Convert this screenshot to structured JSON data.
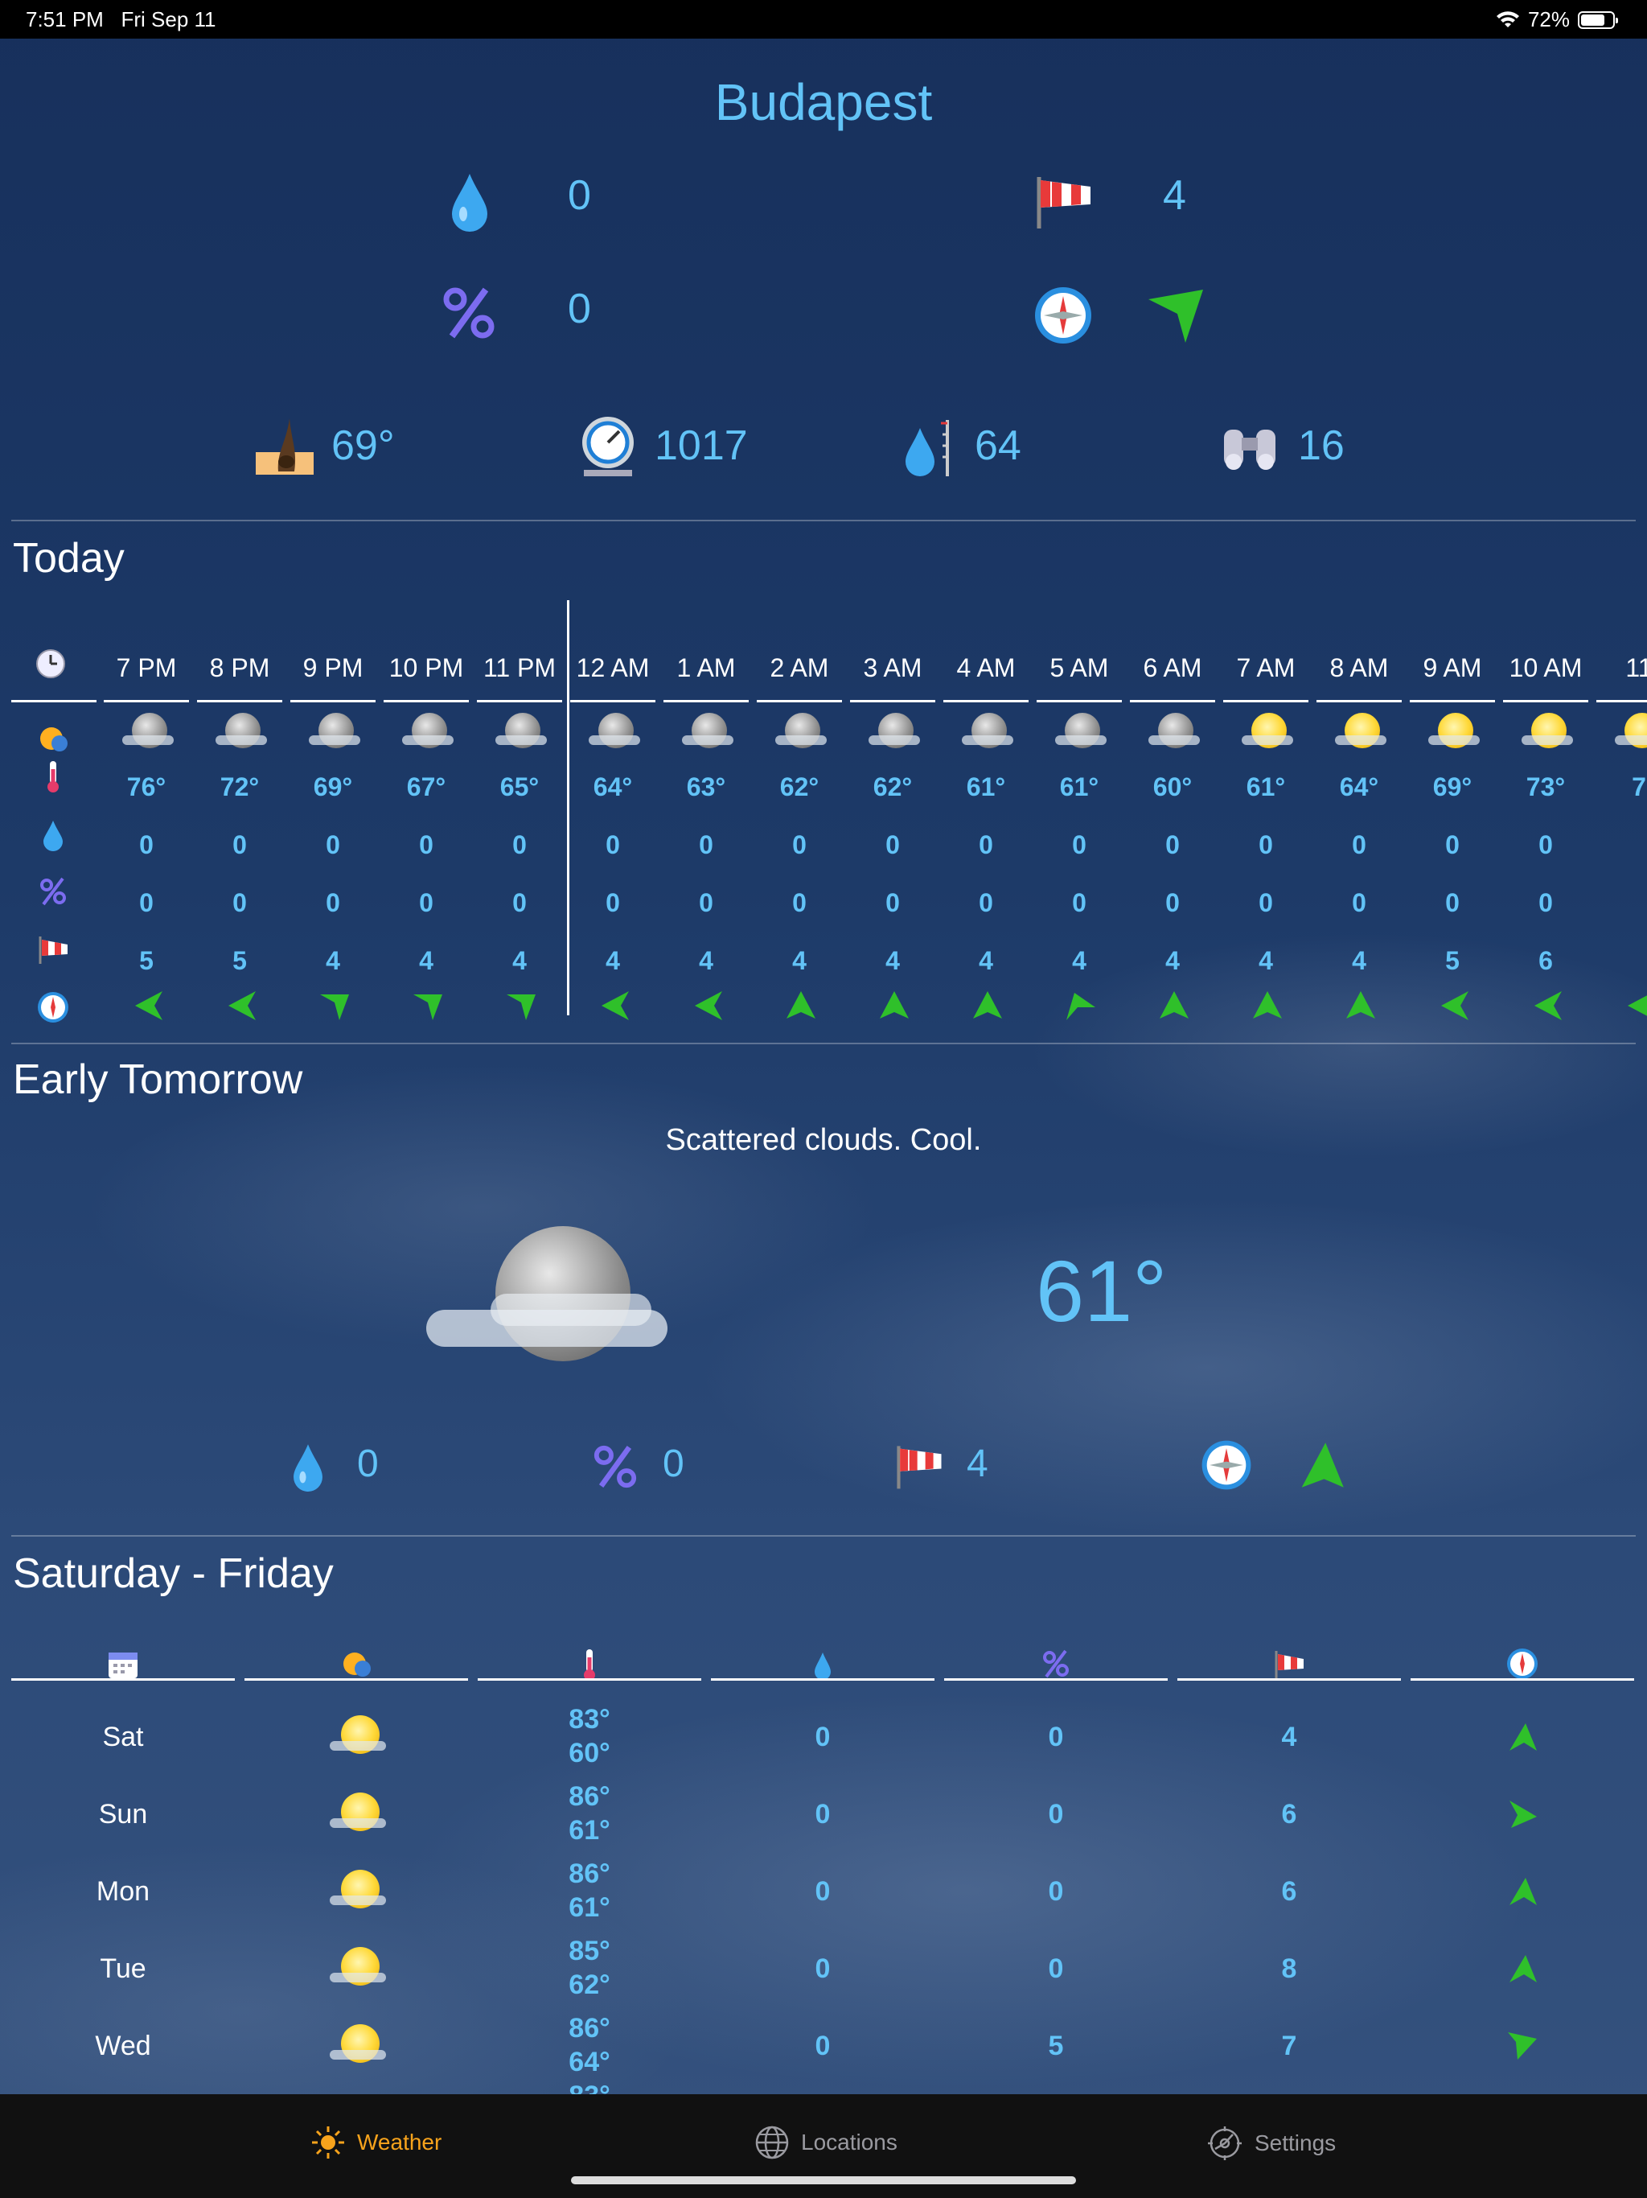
{
  "status": {
    "time": "7:51 PM",
    "date": "Fri Sep 11",
    "battery": "72%"
  },
  "city": "Budapest",
  "current": {
    "precip": "0",
    "precip_chance": "0",
    "wind": "4",
    "feels_like": "69°",
    "pressure": "1017",
    "humidity": "64",
    "visibility": "16"
  },
  "today": {
    "title": "Today",
    "hours": [
      "7 PM",
      "8 PM",
      "9 PM",
      "10 PM",
      "11 PM",
      "12 AM",
      "1 AM",
      "2 AM",
      "3 AM",
      "4 AM",
      "5 AM",
      "6 AM",
      "7 AM",
      "8 AM",
      "9 AM",
      "10 AM",
      "11"
    ],
    "icons": [
      "moon",
      "moon",
      "moon",
      "moon",
      "moon",
      "moon",
      "moon",
      "moon",
      "moon",
      "moon",
      "moon",
      "moon",
      "sun",
      "sun",
      "sun",
      "sun",
      "sun"
    ],
    "temps": [
      "76°",
      "72°",
      "69°",
      "67°",
      "65°",
      "64°",
      "63°",
      "62°",
      "62°",
      "61°",
      "61°",
      "60°",
      "61°",
      "64°",
      "69°",
      "73°",
      "7"
    ],
    "precip": [
      "0",
      "0",
      "0",
      "0",
      "0",
      "0",
      "0",
      "0",
      "0",
      "0",
      "0",
      "0",
      "0",
      "0",
      "0",
      "0",
      ""
    ],
    "chance": [
      "0",
      "0",
      "0",
      "0",
      "0",
      "0",
      "0",
      "0",
      "0",
      "0",
      "0",
      "0",
      "0",
      "0",
      "0",
      "0",
      ""
    ],
    "wind": [
      "5",
      "5",
      "4",
      "4",
      "4",
      "4",
      "4",
      "4",
      "4",
      "4",
      "4",
      "4",
      "4",
      "4",
      "5",
      "6",
      ""
    ]
  },
  "early_tomorrow": {
    "title": "Early Tomorrow",
    "summary": "Scattered clouds. Cool.",
    "temp": "61°",
    "precip": "0",
    "chance": "0",
    "wind": "4"
  },
  "daily": {
    "title": "Saturday - Friday",
    "rows": [
      {
        "day": "Sat",
        "high": "83°",
        "low": "60°",
        "precip": "0",
        "chance": "0",
        "wind": "4"
      },
      {
        "day": "Sun",
        "high": "86°",
        "low": "61°",
        "precip": "0",
        "chance": "0",
        "wind": "6"
      },
      {
        "day": "Mon",
        "high": "86°",
        "low": "61°",
        "precip": "0",
        "chance": "0",
        "wind": "6"
      },
      {
        "day": "Tue",
        "high": "85°",
        "low": "62°",
        "precip": "0",
        "chance": "0",
        "wind": "8"
      },
      {
        "day": "Wed",
        "high": "86°",
        "low": "64°",
        "precip": "0",
        "chance": "5",
        "wind": "7"
      }
    ],
    "partial_next_high": "83°"
  },
  "tabs": {
    "weather": "Weather",
    "locations": "Locations",
    "settings": "Settings"
  },
  "colors": {
    "accent": "#62c3f7",
    "active_tab": "#f7a31c",
    "arrow": "#2fc02a"
  }
}
